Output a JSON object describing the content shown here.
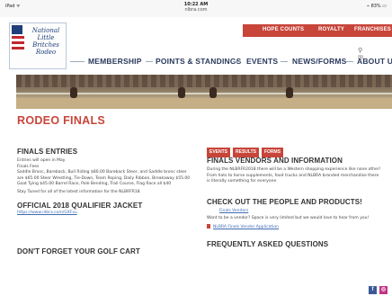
{
  "status_bar": {
    "carrier": "iPad ᯤ",
    "time": "10:22 AM",
    "url": "nlbra.com",
    "battery": "⌁ 83% ▭"
  },
  "logo": {
    "line1": "National",
    "line2": "Little",
    "line3": "Britches",
    "line4": "Rodeo"
  },
  "top_nav": {
    "hope_counts": "HOPE COUNTS",
    "royalty": "ROYALTY",
    "franchises": "FRANCHISES"
  },
  "icons": {
    "search": "search-icon",
    "chat": "chat-icon"
  },
  "main_nav": {
    "membership": "MEMBERSHIP",
    "points": "POINTS & STANDINGS",
    "events": "EVENTS",
    "news": "NEWS/FORMS",
    "about": "ABOUT US"
  },
  "page": {
    "title": "RODEO FINALS"
  },
  "left": {
    "finals_entries_heading": "FINALS ENTRIES",
    "entries_line": "Entries will open in May",
    "finals_fees": "Finals Fees",
    "fees_text": "Saddle Bronc, Bareback, Bull Riding $80.00 Bareback Steer, and Saddle bronc steer are $65.00 Steer Wrestling, Tie-Down, Team Roping, Daily Ribbon, Breakaway $55.00 Goat Tying $45.00 Barrel Race, Pole Bending, Trail Course, Flag Race all $40",
    "stay_tuned": "Stay Tuned for all of the latest information for the NLBRFR18",
    "jacket_heading": "OFFICIAL 2018 QUALIFIER JACKET",
    "jacket_link": "https://www.nlbra.com/GXFsu",
    "golf_heading": "DON'T FORGET YOUR GOLF CART"
  },
  "right": {
    "pill_events": "EVENTS",
    "pill_results": "RESULTS",
    "pill_forms": "FORMS",
    "vendors_heading": "FINALS VENDORS AND INFORMATION",
    "vendors_text": "During the NLBRFR2018 there will be a Western shopping experience like none other! From hats to horse supplements, food trucks and NLBRA branded merchandise there is literally something for everyone",
    "people_heading": "CHECK OUT THE PEOPLE AND PRODUCTS!",
    "finals_vendors_link": "Finals Vendors",
    "want_vendor": "Want to be a vendor? Space is very limited but we would love to hear from you!",
    "application_link": "NLBRA Finals Vendor Application",
    "faq_heading": "FREQUENTLY ASKED QUESTIONS"
  },
  "social": {
    "facebook": "f",
    "instagram": "◎"
  },
  "colors": {
    "accent": "#c8453a",
    "nav_text": "#2a3a5c",
    "link": "#3f6bb3",
    "facebook": "#3b5998",
    "instagram": "#c13584"
  }
}
